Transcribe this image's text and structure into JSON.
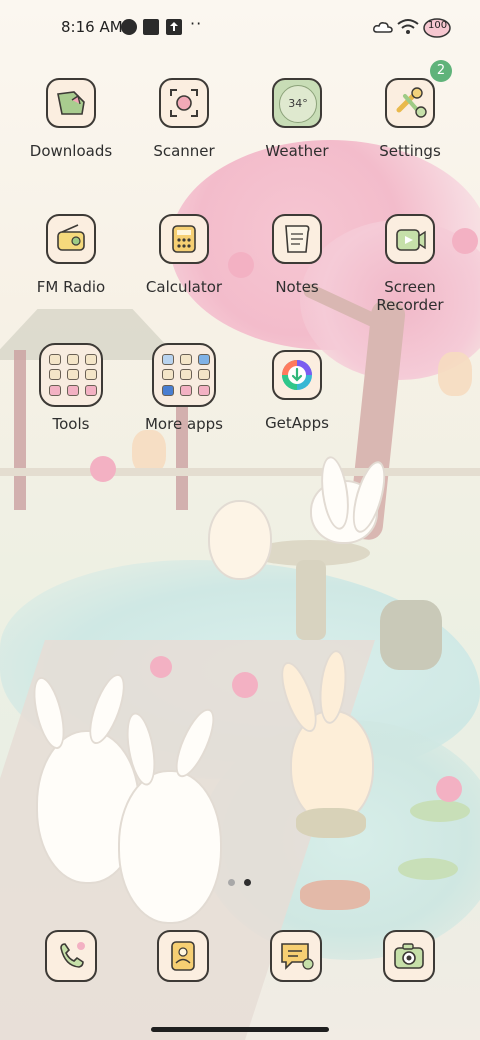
{
  "status_bar": {
    "time": "8:16 AM",
    "overflow": "··",
    "left_icons": [
      "data-saver-icon",
      "notification-square-icon",
      "upload-icon"
    ],
    "right_icons": [
      "cloud-icon",
      "wifi-icon",
      "battery-icon"
    ],
    "battery_level": "100"
  },
  "apps": [
    {
      "label": "Downloads",
      "icon": "download-folder-icon"
    },
    {
      "label": "Scanner",
      "icon": "scanner-icon"
    },
    {
      "label": "Weather",
      "icon": "weather-icon",
      "icon_text": "34°"
    },
    {
      "label": "Settings",
      "icon": "settings-icon",
      "badge": "2"
    },
    {
      "label": "FM Radio",
      "icon": "radio-icon"
    },
    {
      "label": "Calculator",
      "icon": "calculator-icon"
    },
    {
      "label": "Notes",
      "icon": "notes-icon"
    },
    {
      "label": "Screen\nRecorder",
      "icon": "screen-recorder-icon"
    },
    {
      "label": "Tools",
      "icon": "folder-icon"
    },
    {
      "label": "More apps",
      "icon": "folder-icon"
    },
    {
      "label": "GetApps",
      "icon": "getapps-icon"
    }
  ],
  "page_indicator": {
    "pages": 2,
    "current": 2
  },
  "dock": [
    {
      "icon": "phone-icon"
    },
    {
      "icon": "contacts-icon"
    },
    {
      "icon": "messages-icon"
    },
    {
      "icon": "camera-icon"
    }
  ],
  "colors": {
    "badge": "#5fb37a",
    "icon_bg": "#fbeee0",
    "icon_border": "#3d3a36"
  }
}
